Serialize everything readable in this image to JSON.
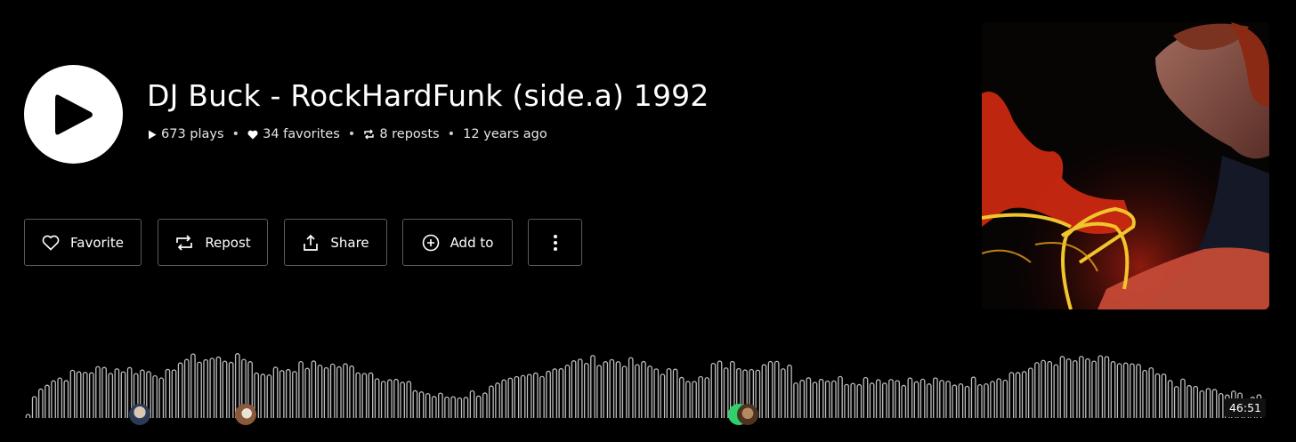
{
  "track": {
    "title": "DJ Buck - RockHardFunk (side.a) 1992",
    "plays": "673 plays",
    "favorites": "34 favorites",
    "reposts": "8 reposts",
    "age": "12 years ago",
    "separator": "•"
  },
  "actions": {
    "favorite": "Favorite",
    "repost": "Repost",
    "share": "Share",
    "add_to": "Add to"
  },
  "player": {
    "duration": "46:51"
  },
  "icons": {
    "play": "play-icon",
    "favorite": "heart-icon",
    "repost": "repost-icon",
    "share": "share-icon",
    "add_to": "plus-circle-icon",
    "more": "more-vertical-icon"
  },
  "colors": {
    "background": "#000000",
    "text": "#ffffff",
    "waveform": "#bdbdbd",
    "button_border": "#5a5a5a"
  }
}
